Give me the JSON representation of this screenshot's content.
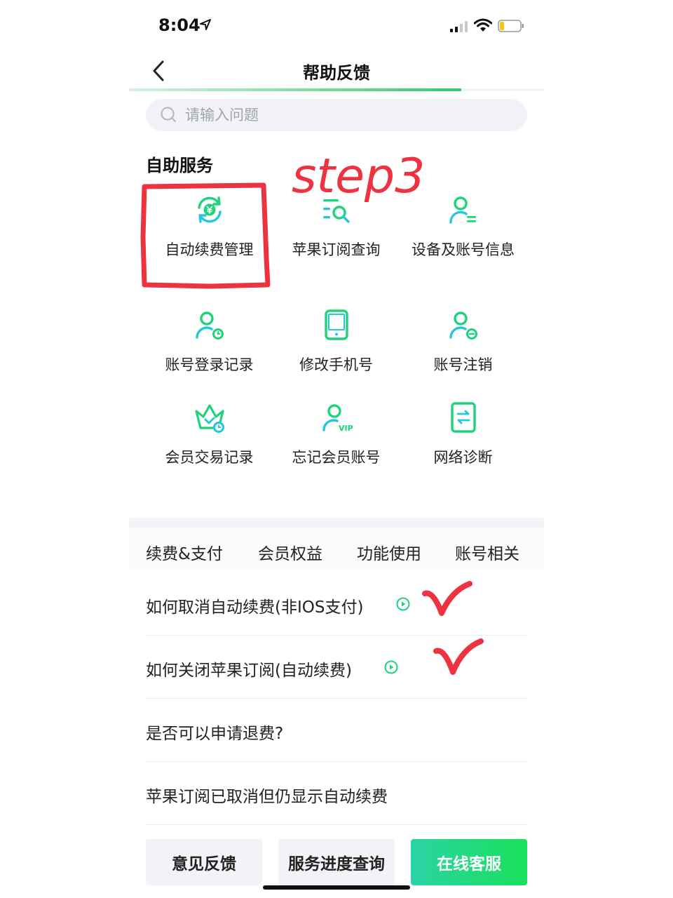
{
  "status_bar": {
    "time": "8:04"
  },
  "nav": {
    "title": "帮助反馈",
    "progress": 0.8
  },
  "search": {
    "placeholder": "请输入问题"
  },
  "self_service": {
    "title": "自助服务",
    "items": [
      {
        "label": "自动续费管理",
        "icon": "auto-renew-yuan-icon"
      },
      {
        "label": "苹果订阅查询",
        "icon": "list-search-icon"
      },
      {
        "label": "设备及账号信息",
        "icon": "user-list-icon"
      },
      {
        "label": "账号登录记录",
        "icon": "user-clock-icon"
      },
      {
        "label": "修改手机号",
        "icon": "phone-icon"
      },
      {
        "label": "账号注销",
        "icon": "user-minus-icon"
      },
      {
        "label": "会员交易记录",
        "icon": "crown-clock-icon"
      },
      {
        "label": "忘记会员账号",
        "icon": "user-vip-icon"
      },
      {
        "label": "网络诊断",
        "icon": "network-swap-icon"
      }
    ]
  },
  "tabs": [
    {
      "label": "续费&支付"
    },
    {
      "label": "会员权益"
    },
    {
      "label": "功能使用"
    },
    {
      "label": "账号相关"
    }
  ],
  "faq": [
    {
      "text": "如何取消自动续费(非IOS支付)",
      "video": true
    },
    {
      "text": "如何关闭苹果订阅(自动续费)",
      "video": true
    },
    {
      "text": "是否可以申请退费?",
      "video": false
    },
    {
      "text": "苹果订阅已取消但仍显示自动续费",
      "video": false
    }
  ],
  "bottom_bar": {
    "feedback": "意见反馈",
    "progress_query": "服务进度查询",
    "online_service": "在线客服"
  },
  "annotation": {
    "step_text": "step3",
    "color": "#ee3340"
  },
  "colors": {
    "accent_green": "#1fd37a",
    "accent_teal": "#24c8d8"
  }
}
